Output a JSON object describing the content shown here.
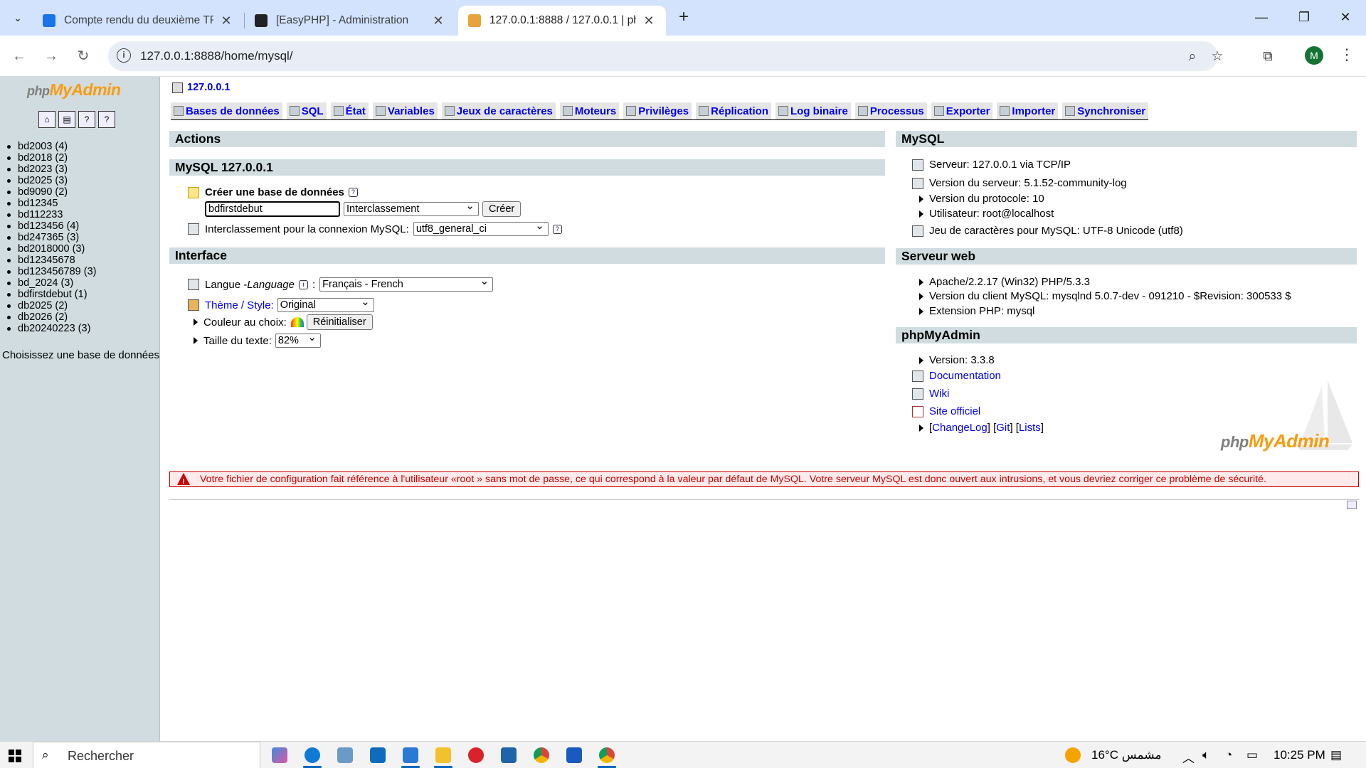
{
  "browser": {
    "tabs": [
      {
        "title": "Compte rendu du deuxième TP",
        "active": false
      },
      {
        "title": "[EasyPHP] - Administration",
        "active": false
      },
      {
        "title": "127.0.0.1:8888 / 127.0.0.1 | phpMyAdmin",
        "active": true
      }
    ],
    "url": "127.0.0.1:8888/home/mysql/",
    "profile_initial": "M",
    "new_tab_label": "+"
  },
  "left": {
    "logo_php": "php",
    "logo_myadmin": "MyAdmin",
    "databases": [
      "bd2003 (4)",
      "bd2018 (2)",
      "bd2023 (3)",
      "bd2025 (3)",
      "bd9090 (2)",
      "bd12345",
      "bd112233",
      "bd123456 (4)",
      "bd247365 (3)",
      "bd2018000 (3)",
      "bd12345678",
      "bd123456789 (3)",
      "bd_2024 (3)",
      "bdfirstdebut (1)",
      "db2025 (2)",
      "db2026 (2)",
      "db20240223 (3)"
    ],
    "choose_db": "Choisissez une base de données"
  },
  "main": {
    "server": "127.0.0.1",
    "menu": [
      "Bases de données",
      "SQL",
      "État",
      "Variables",
      "Jeux de caractères",
      "Moteurs",
      "Privilèges",
      "Réplication",
      "Log binaire",
      "Processus",
      "Exporter",
      "Importer",
      "Synchroniser"
    ],
    "actions": {
      "title": "Actions",
      "mysql_title": "MySQL 127.0.0.1",
      "create_label": "Créer une base de données",
      "new_db_value": "bdfirstdebut",
      "collation_select": "Interclassement",
      "create_button": "Créer",
      "conn_collation_label": "Interclassement pour la connexion MySQL:",
      "conn_collation_value": "utf8_general_ci"
    },
    "interface": {
      "title": "Interface",
      "lang_label": "Langue - ",
      "lang_label_italic": "Language",
      "lang_colon": ":",
      "lang_value": "Français - French",
      "theme_label": "Thème / Style:",
      "theme_value": "Original",
      "color_label": "Couleur au choix:",
      "reset_button": "Réinitialiser",
      "text_size_label": "Taille du texte:",
      "text_size_value": "82%"
    },
    "mysql": {
      "title": "MySQL",
      "server": "Serveur: 127.0.0.1 via TCP/IP",
      "version": "Version du serveur: 5.1.52-community-log",
      "protocol": "Version du protocole: 10",
      "user": "Utilisateur: root@localhost",
      "charset": "Jeu de caractères pour MySQL: UTF-8 Unicode (utf8)"
    },
    "webserver": {
      "title": "Serveur web",
      "apache": "Apache/2.2.17 (Win32) PHP/5.3.3",
      "client": "Version du client MySQL: mysqlnd 5.0.7-dev - 091210 - $Revision: 300533 $",
      "ext": "Extension PHP: mysql"
    },
    "pma": {
      "title": "phpMyAdmin",
      "version": "Version: 3.3.8",
      "doc": "Documentation",
      "wiki": "Wiki",
      "site": "Site officiel",
      "changelog": "ChangeLog",
      "git": "Git",
      "lists": "Lists"
    },
    "warning": "Votre fichier de configuration fait référence à l'utilisateur «root » sans mot de passe, ce qui correspond à la valeur par défaut de MySQL. Votre serveur MySQL est donc ouvert aux intrusions, et vous devriez corriger ce problème de sécurité.",
    "logo_php": "php",
    "logo_myadmin": "MyAdmin"
  },
  "taskbar": {
    "search_placeholder": "Rechercher",
    "weather": "16°C  مشمس",
    "time": "10:25 PM"
  },
  "colors": {
    "tabbar": "#d3e3fd",
    "pma_panel": "#d0dce0",
    "link": "#0000ee",
    "warning": "#cc0000",
    "logo_orange": "#f89c0e"
  }
}
